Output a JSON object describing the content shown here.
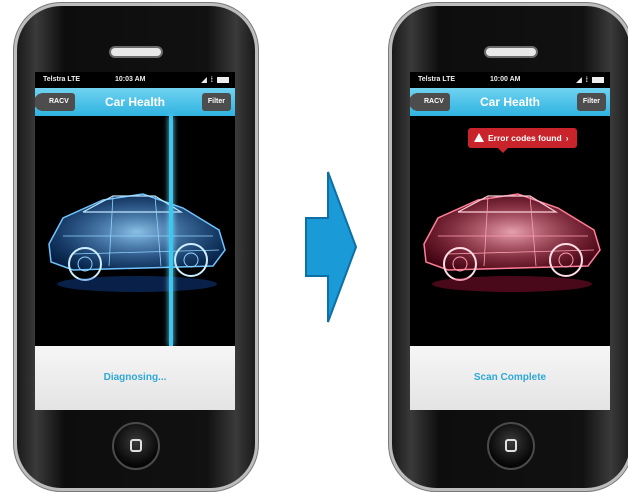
{
  "left_screen": {
    "status": {
      "carrier": "Telstra LTE",
      "time": "10:03 AM"
    },
    "nav": {
      "back_label": "RACV",
      "title": "Car Health",
      "filter_label": "Filter"
    },
    "footer_text": "Diagnosing...",
    "car_color": "#2f8dff"
  },
  "right_screen": {
    "status": {
      "carrier": "Telstra LTE",
      "time": "10:00 AM"
    },
    "nav": {
      "back_label": "RACV",
      "title": "Car Health",
      "filter_label": "Filter"
    },
    "alert_text": "Error codes found",
    "footer_text": "Scan Complete",
    "car_color": "#ff3a5a"
  },
  "colors": {
    "nav": "#2fb3e0",
    "accent": "#2fa8d6",
    "error": "#c9242b",
    "arrow": "#1a9ad6"
  }
}
